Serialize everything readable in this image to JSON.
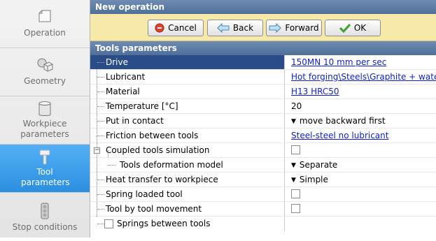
{
  "sidebar": {
    "items": [
      {
        "label": "Operation"
      },
      {
        "label": "Geometry"
      },
      {
        "label": "Workpiece parameters"
      },
      {
        "label": "Tool parameters"
      },
      {
        "label": "Stop conditions"
      }
    ]
  },
  "header": {
    "title": "New operation"
  },
  "toolbar": {
    "cancel_label": "Cancel",
    "back_label": "Back",
    "forward_label": "Forward",
    "ok_label": "OK"
  },
  "section": {
    "title": "Tools parameters"
  },
  "params": {
    "drive": {
      "label": "Drive",
      "value": "150MN 10 mm per sec"
    },
    "lubricant": {
      "label": "Lubricant",
      "value": "Hot forging\\Steels\\Graphite + water"
    },
    "material": {
      "label": "Material",
      "value": "H13 HRC50"
    },
    "temperature": {
      "label": "Temperature [°C]",
      "value": "20"
    },
    "put_in_contact": {
      "label": "Put in contact",
      "value": "move backward first"
    },
    "friction": {
      "label": "Friction between tools",
      "value": "Steel-steel no lubricant"
    },
    "coupled": {
      "label": "Coupled tools simulation",
      "checked": false
    },
    "deformation_model": {
      "label": "Tools deformation model",
      "value": "Separate"
    },
    "heat_transfer": {
      "label": "Heat transfer to workpiece",
      "value": "Simple"
    },
    "spring_loaded": {
      "label": "Spring loaded tool",
      "checked": false
    },
    "tool_by_tool": {
      "label": "Tool by tool movement",
      "checked": false
    },
    "springs_between": {
      "label": "Springs between tools",
      "checked": false
    }
  },
  "colors": {
    "selected_row": "#2a4d8a",
    "active_nav": "#3d9ee9",
    "toolbar_bg": "#f7e9a8",
    "header_bg": "#5f7ea8"
  }
}
